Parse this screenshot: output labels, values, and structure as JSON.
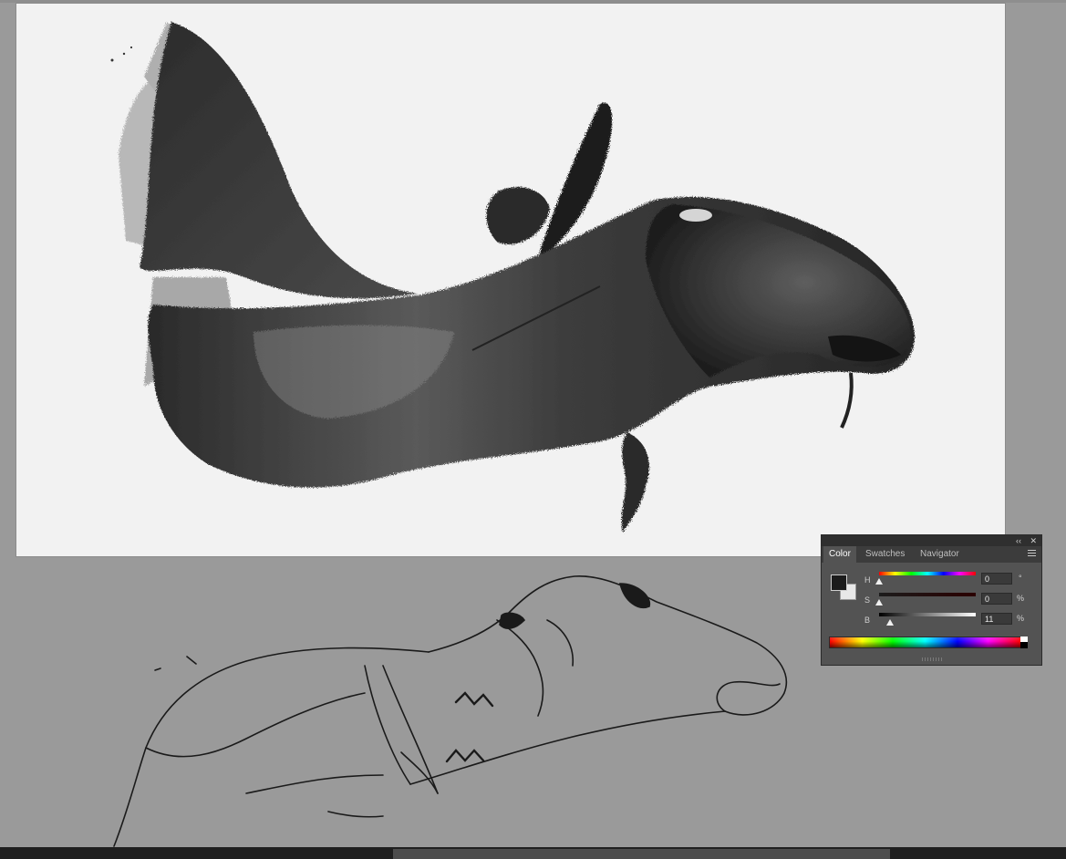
{
  "color_panel": {
    "tabs": [
      {
        "label": "Color",
        "active": true
      },
      {
        "label": "Swatches",
        "active": false
      },
      {
        "label": "Navigator",
        "active": false
      }
    ],
    "collapse_icon": "double-chevron-left-icon",
    "close_icon": "close-icon",
    "menu_icon": "panel-menu-icon",
    "collapse_glyph": "‹‹",
    "close_glyph": "✕",
    "foreground_color": "#1c1c1c",
    "background_color": "#e8e8e8",
    "sliders": [
      {
        "label": "H",
        "value": "0",
        "unit": "°",
        "fraction": 0.0
      },
      {
        "label": "S",
        "value": "0",
        "unit": "%",
        "fraction": 0.0
      },
      {
        "label": "B",
        "value": "11",
        "unit": "%",
        "fraction": 0.11
      }
    ]
  },
  "document": {
    "canvas_background": "#f2f2f2",
    "workspace_background": "#9a9a9a"
  },
  "scrollbar": {
    "thumb_start_fraction": 0.369,
    "thumb_span_fraction": 0.466
  }
}
